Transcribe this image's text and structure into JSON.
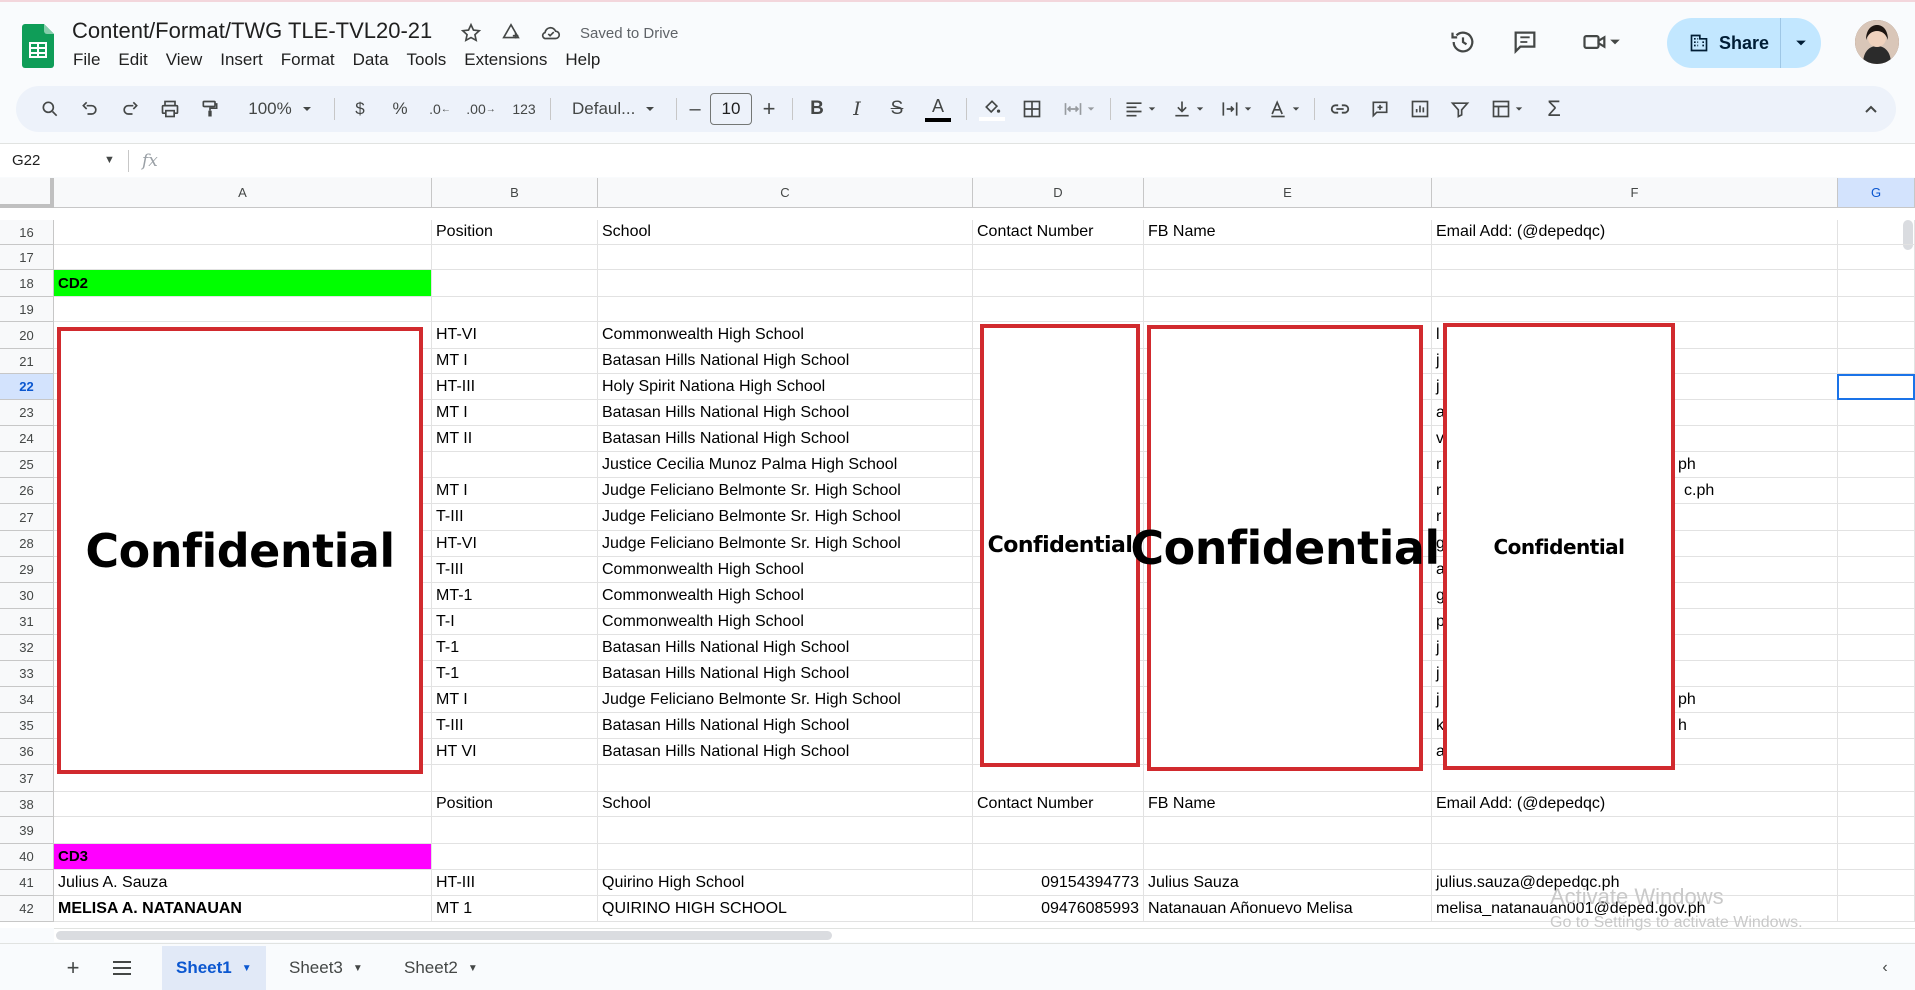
{
  "app": {
    "doc_title": "Content/Format/TWG TLE-TVL20-21",
    "saved_status": "Saved to Drive",
    "menu": [
      "File",
      "Edit",
      "View",
      "Insert",
      "Format",
      "Data",
      "Tools",
      "Extensions",
      "Help"
    ],
    "share_label": "Share"
  },
  "toolbar": {
    "zoom": "100%",
    "currency": "$",
    "percent": "%",
    "dec_decrease": ".0",
    "dec_increase": ".00",
    "number_format": "123",
    "font": "Defaul...",
    "font_size": "10",
    "minus": "–",
    "plus": "+",
    "bold": "B",
    "italic": "I",
    "strike": "S",
    "textcolor": "A",
    "sigma": "Σ"
  },
  "formula_bar": {
    "name_box": "G22",
    "fx": "fx"
  },
  "columns": [
    "A",
    "B",
    "C",
    "D",
    "E",
    "F",
    "G"
  ],
  "rows": [
    {
      "n": "16",
      "a": "",
      "b": "Position",
      "c": "School",
      "d": "Contact Number",
      "e": "FB Name",
      "f": "Email Add: (@depedqc)"
    },
    {
      "n": "17",
      "a": "",
      "b": "",
      "c": "",
      "d": "",
      "e": "",
      "f": ""
    },
    {
      "n": "18",
      "a": "CD2",
      "b": "",
      "c": "",
      "d": "",
      "e": "",
      "f": ""
    },
    {
      "n": "19",
      "a": "",
      "b": "",
      "c": "",
      "d": "",
      "e": "",
      "f": ""
    },
    {
      "n": "20",
      "a": "",
      "b": "HT-VI",
      "c": "Commonwealth High School",
      "d": "",
      "e": "",
      "f": "l"
    },
    {
      "n": "21",
      "a": "",
      "b": "MT I",
      "c": "Batasan Hills National High School",
      "d": "",
      "e": "",
      "f": "j"
    },
    {
      "n": "22",
      "a": "",
      "b": "HT-III",
      "c": "Holy Spirit Nationa High School",
      "d": "",
      "e": "",
      "f": "j"
    },
    {
      "n": "23",
      "a": "",
      "b": "MT I",
      "c": "Batasan Hills National High School",
      "d": "",
      "e": "",
      "f": "a"
    },
    {
      "n": "24",
      "a": "",
      "b": "MT II",
      "c": "Batasan Hills National High School",
      "d": "",
      "e": "",
      "f": "v"
    },
    {
      "n": "25",
      "a": "",
      "b": "",
      "c": "Justice Cecilia Munoz Palma High School",
      "d": "",
      "e": "",
      "f": "r"
    },
    {
      "n": "26",
      "a": "",
      "b": "MT I",
      "c": "Judge Feliciano Belmonte Sr. High School",
      "d": "",
      "e": "",
      "f": "r"
    },
    {
      "n": "27",
      "a": "",
      "b": "T-III",
      "c": "Judge Feliciano Belmonte Sr. High School",
      "d": "",
      "e": "",
      "f": "r"
    },
    {
      "n": "28",
      "a": "",
      "b": "HT-VI",
      "c": "Judge Feliciano Belmonte Sr. High School",
      "d": "",
      "e": "",
      "f": "g"
    },
    {
      "n": "29",
      "a": "",
      "b": "T-III",
      "c": "Commonwealth High School",
      "d": "",
      "e": "",
      "f": "a"
    },
    {
      "n": "30",
      "a": "",
      "b": "MT-1",
      "c": "Commonwealth High School",
      "d": "",
      "e": "",
      "f": "g"
    },
    {
      "n": "31",
      "a": "",
      "b": "T-I",
      "c": "Commonwealth High School",
      "d": "",
      "e": "",
      "f": "p"
    },
    {
      "n": "32",
      "a": "",
      "b": "T-1",
      "c": "Batasan Hills National High School",
      "d": "",
      "e": "",
      "f": "j"
    },
    {
      "n": "33",
      "a": "",
      "b": "T-1",
      "c": "Batasan Hills National High School",
      "d": "",
      "e": "",
      "f": "j"
    },
    {
      "n": "34",
      "a": "",
      "b": "MT I",
      "c": "Judge Feliciano Belmonte Sr. High School",
      "d": "",
      "e": "",
      "f": "j"
    },
    {
      "n": "35",
      "a": "",
      "b": "T-III",
      "c": "Batasan Hills National High School",
      "d": "",
      "e": "",
      "f": "k"
    },
    {
      "n": "36",
      "a": "",
      "b": "HT VI",
      "c": "Batasan Hills National High School",
      "d": "",
      "e": "",
      "f": "a"
    },
    {
      "n": "37",
      "a": "",
      "b": "",
      "c": "",
      "d": "",
      "e": "",
      "f": ""
    },
    {
      "n": "38",
      "a": "",
      "b": "Position",
      "c": "School",
      "d": "Contact Number",
      "e": "FB Name",
      "f": "Email Add: (@depedqc)"
    },
    {
      "n": "39",
      "a": "",
      "b": "",
      "c": "",
      "d": "",
      "e": "",
      "f": ""
    },
    {
      "n": "40",
      "a": "CD3",
      "b": "",
      "c": "",
      "d": "",
      "e": "",
      "f": ""
    },
    {
      "n": "41",
      "a": "Julius A. Sauza",
      "b": "HT-III",
      "c": "Quirino High School",
      "d": "09154394773",
      "e": "Julius Sauza",
      "f": "julius.sauza@depedqc.ph"
    },
    {
      "n": "42",
      "a": "MELISA A. NATANAUAN",
      "b": "MT 1",
      "c": "QUIRINO HIGH SCHOOL",
      "d": "09476085993",
      "e": "Natanauan Añonuevo Melisa",
      "f": "melisa_natanauan001@deped.gov.ph"
    }
  ],
  "email_overflow": {
    "r25": "ph",
    "r26": "c.ph",
    "r34": "ph",
    "r35": "h"
  },
  "confidential": {
    "label": "Confidential"
  },
  "watermark": {
    "line1": "Activate Windows",
    "line2": "Go to Settings to activate Windows."
  },
  "sheets": [
    {
      "name": "Sheet1",
      "active": true
    },
    {
      "name": "Sheet3",
      "active": false
    },
    {
      "name": "Sheet2",
      "active": false
    }
  ],
  "colors": {
    "cd2": "#00ff00",
    "cd3": "#ff00ff",
    "redact_border": "#d12a2e",
    "share_bg": "#c2e7ff"
  }
}
